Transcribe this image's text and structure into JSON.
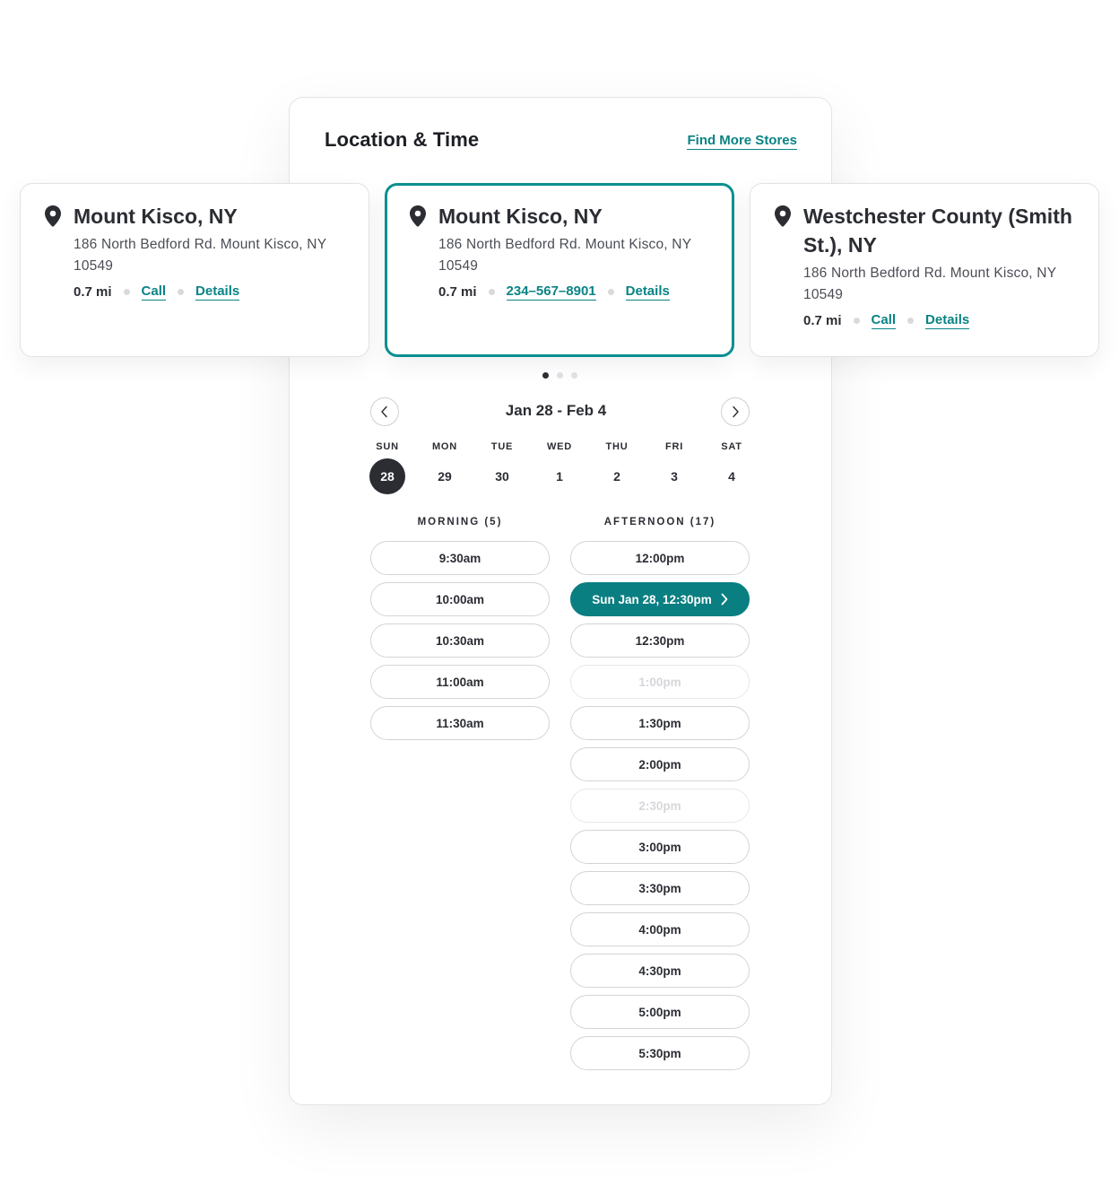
{
  "panel": {
    "title": "Location & Time",
    "find_more": "Find More Stores"
  },
  "stores": [
    {
      "name": "Mount Kisco, NY",
      "address": "186 North Bedford Rd. Mount Kisco, NY 10549",
      "distance": "0.7 mi",
      "contact": "Call",
      "details": "Details",
      "icon": "map-pin-icon"
    },
    {
      "name": "Mount Kisco, NY",
      "address": "186 North Bedford Rd. Mount Kisco, NY 10549",
      "distance": "0.7 mi",
      "contact": "234–567–8901",
      "details": "Details",
      "icon": "map-pin-icon",
      "selected": true
    },
    {
      "name": "Westchester County (Smith St.), NY",
      "address": "186 North Bedford Rd. Mount Kisco, NY 10549",
      "distance": "0.7 mi",
      "contact": "Call",
      "details": "Details",
      "icon": "map-pin-icon"
    }
  ],
  "carousel": {
    "pages": 3,
    "active": 0
  },
  "calendar": {
    "range_label": "Jan 28 - Feb 4",
    "prev_icon": "chevron-left-icon",
    "next_icon": "chevron-right-icon",
    "days": [
      {
        "name": "SUN",
        "num": "28",
        "selected": true
      },
      {
        "name": "MON",
        "num": "29"
      },
      {
        "name": "TUE",
        "num": "30"
      },
      {
        "name": "WED",
        "num": "1"
      },
      {
        "name": "THU",
        "num": "2"
      },
      {
        "name": "FRI",
        "num": "3"
      },
      {
        "name": "SAT",
        "num": "4"
      }
    ]
  },
  "slots": {
    "morning_label": "MORNING (5)",
    "afternoon_label": "AFTERNOON (17)",
    "morning": [
      {
        "label": "9:30am"
      },
      {
        "label": "10:00am"
      },
      {
        "label": "10:30am"
      },
      {
        "label": "11:00am"
      },
      {
        "label": "11:30am"
      }
    ],
    "afternoon": [
      {
        "label": "12:00pm"
      },
      {
        "label": "Sun Jan 28, 12:30pm",
        "selected": true
      },
      {
        "label": "12:30pm"
      },
      {
        "label": "1:00pm",
        "disabled": true
      },
      {
        "label": "1:30pm"
      },
      {
        "label": "2:00pm"
      },
      {
        "label": "2:30pm",
        "disabled": true
      },
      {
        "label": "3:00pm"
      },
      {
        "label": "3:30pm"
      },
      {
        "label": "4:00pm"
      },
      {
        "label": "4:30pm"
      },
      {
        "label": "5:00pm"
      },
      {
        "label": "5:30pm"
      }
    ]
  },
  "colors": {
    "accent": "#0a8384",
    "selected_slot": "#0a7f82",
    "dark": "#2b2d33"
  }
}
